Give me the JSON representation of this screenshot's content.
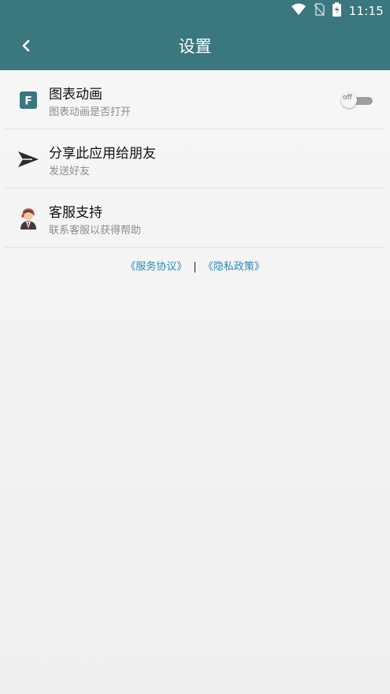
{
  "status": {
    "time": "11:15"
  },
  "header": {
    "title": "设置"
  },
  "settings": [
    {
      "title": "图表动画",
      "subtitle": "图表动画是否打开",
      "icon_letter": "F",
      "toggle_label": "off"
    },
    {
      "title": "分享此应用给朋友",
      "subtitle": "发送好友"
    },
    {
      "title": "客服支持",
      "subtitle": "联系客服以获得帮助"
    }
  ],
  "footer": {
    "service": "《服务协议》",
    "separator": "|",
    "privacy": "《隐私政策》"
  }
}
